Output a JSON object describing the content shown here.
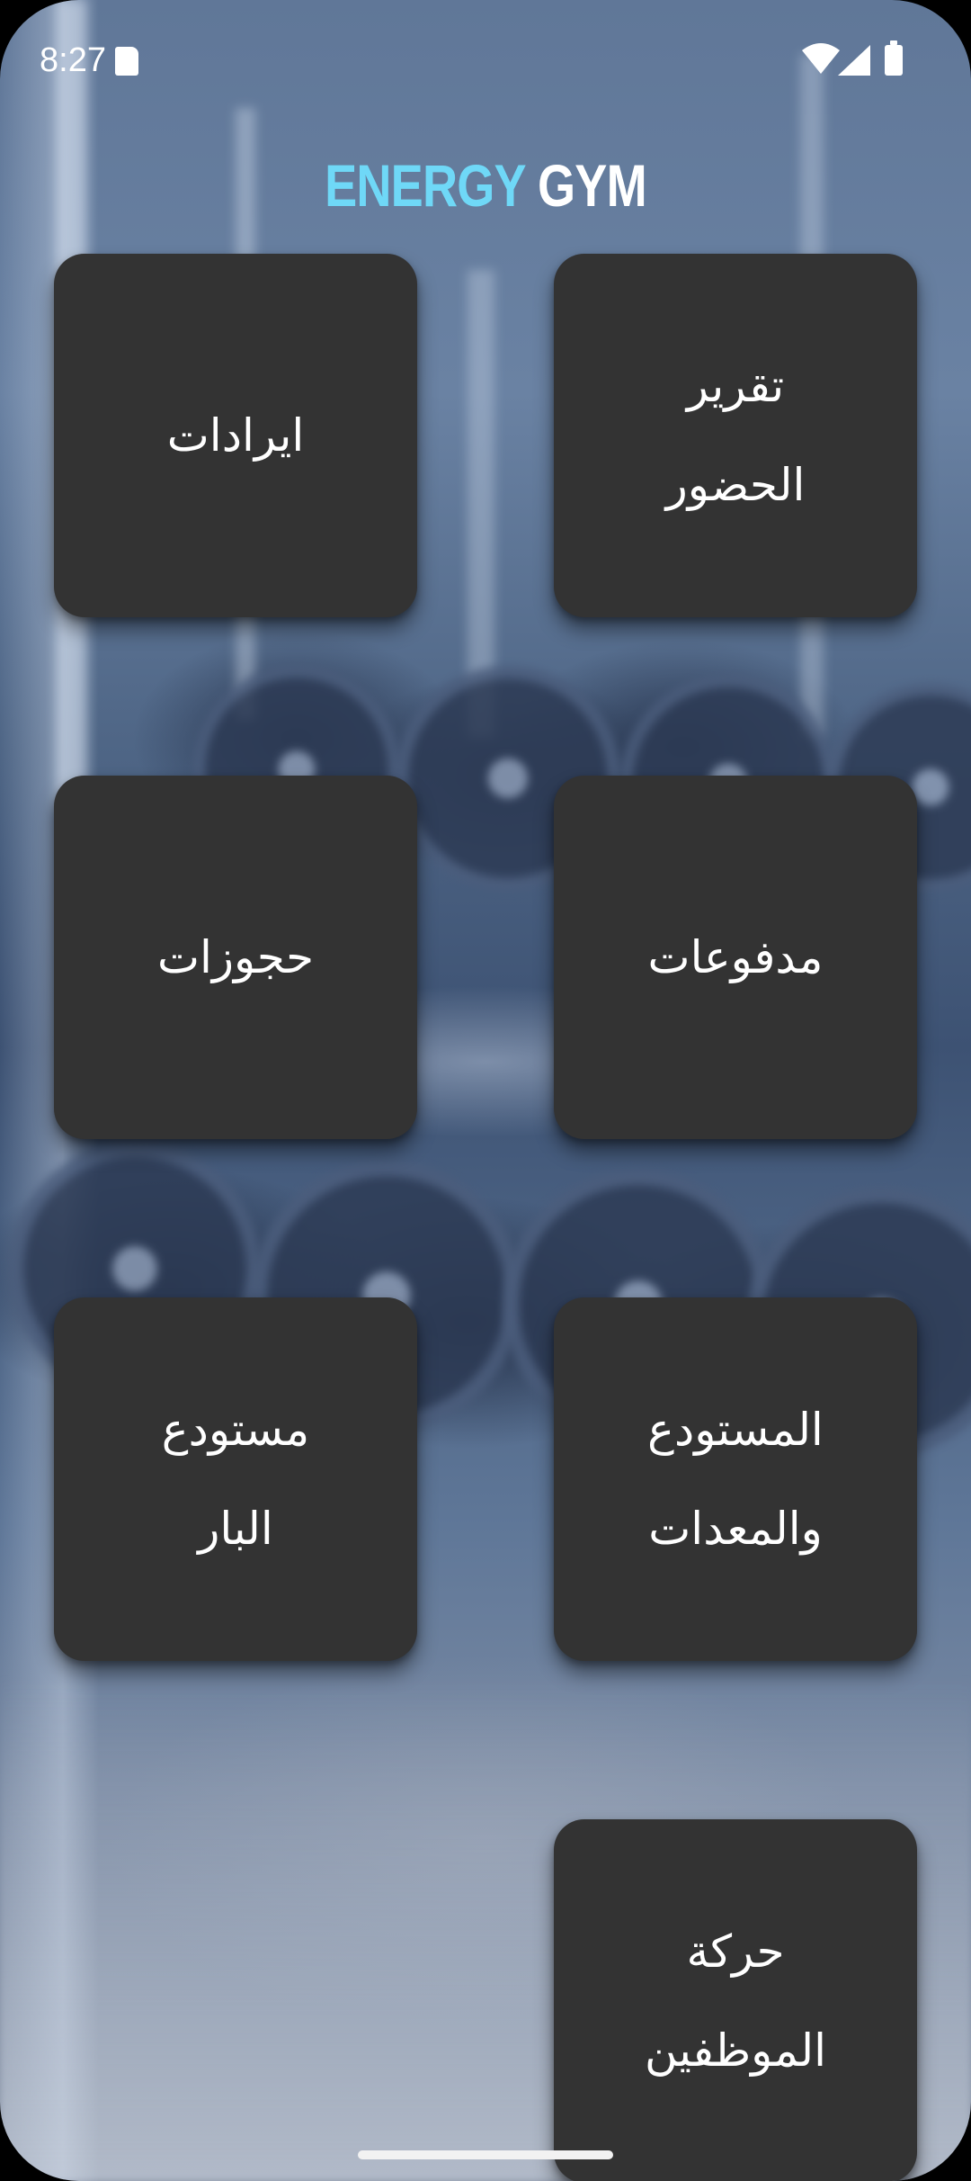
{
  "status_bar": {
    "time": "8:27",
    "icons": [
      "sd-card-icon",
      "wifi-icon",
      "signal-icon",
      "battery-icon"
    ]
  },
  "header": {
    "title_part1": "ENERGY",
    "title_part2": "GYM"
  },
  "colors": {
    "title_accent": "#6fd8f7",
    "title_primary": "#ffffff",
    "tile_background": "#333333",
    "tile_text": "#ffffff"
  },
  "menu": {
    "tiles": [
      {
        "id": "revenues",
        "label": "ايرادات"
      },
      {
        "id": "attendance-report",
        "label": "تقرير\nالحضور"
      },
      {
        "id": "bookings",
        "label": "حجوزات"
      },
      {
        "id": "payments",
        "label": "مدفوعات"
      },
      {
        "id": "bar-warehouse",
        "label": "مستودع\nالبار"
      },
      {
        "id": "warehouse-equipment",
        "label": "المستودع\nوالمعدات"
      },
      {
        "id": "staff-movement",
        "label": "حركة\nالموظفين"
      }
    ]
  }
}
